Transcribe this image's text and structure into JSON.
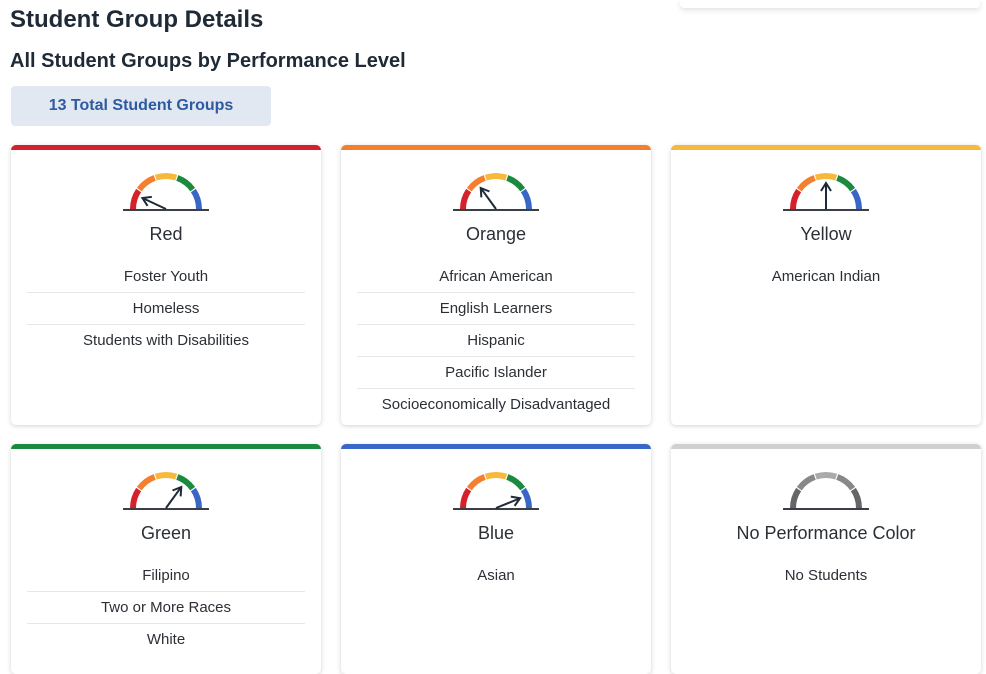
{
  "header": {
    "title": "Student Group Details",
    "subtitle": "All Student Groups by Performance Level",
    "total_badge": "13 Total Student Groups"
  },
  "colors": {
    "red": "#d3222a",
    "orange": "#f47f2f",
    "yellow": "#f6b93b",
    "green": "#1b8a3e",
    "blue": "#3a67c6",
    "gray": "#d0d0d0"
  },
  "cards": [
    {
      "label": "Red",
      "accent": "#d3222a",
      "gauge_level": "red",
      "groups": [
        "Foster Youth",
        "Homeless",
        "Students with Disabilities"
      ]
    },
    {
      "label": "Orange",
      "accent": "#f47f2f",
      "gauge_level": "orange",
      "groups": [
        "African American",
        "English Learners",
        "Hispanic",
        "Pacific Islander",
        "Socioeconomically Disadvantaged"
      ]
    },
    {
      "label": "Yellow",
      "accent": "#f6b93b",
      "gauge_level": "yellow",
      "groups": [
        "American Indian"
      ]
    },
    {
      "label": "Green",
      "accent": "#1b8a3e",
      "gauge_level": "green",
      "groups": [
        "Filipino",
        "Two or More Races",
        "White"
      ]
    },
    {
      "label": "Blue",
      "accent": "#3a67c6",
      "gauge_level": "blue",
      "groups": [
        "Asian"
      ]
    },
    {
      "label": "No Performance Color",
      "accent": "#d0d0d0",
      "gauge_level": "none",
      "groups": [
        "No Students"
      ]
    }
  ]
}
